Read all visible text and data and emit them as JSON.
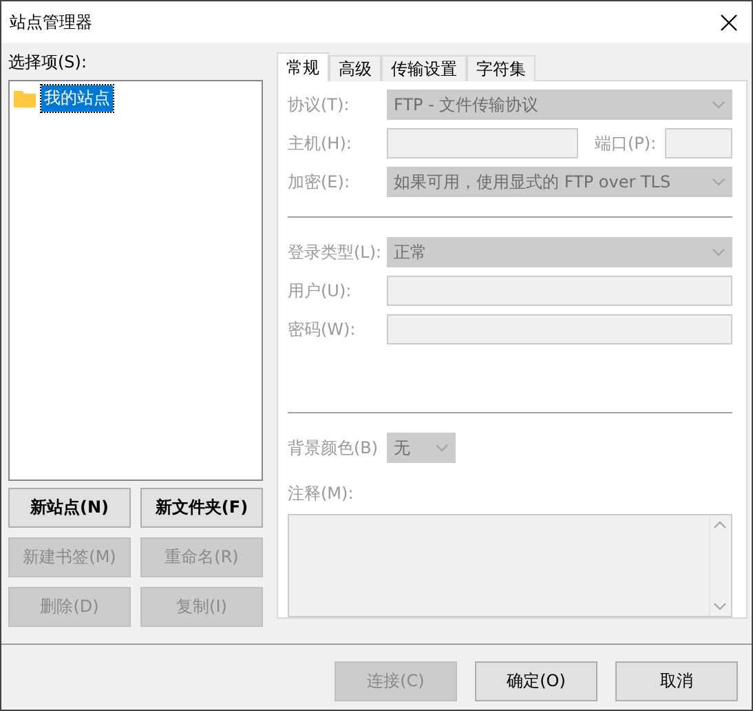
{
  "window": {
    "title": "站点管理器"
  },
  "tree": {
    "label": "选择项(S):",
    "items": [
      {
        "label": "我的站点",
        "selected": true
      }
    ]
  },
  "left_buttons": [
    {
      "label": "新站点(N)",
      "disabled": false
    },
    {
      "label": "新文件夹(F)",
      "disabled": false
    },
    {
      "label": "新建书签(M)",
      "disabled": true
    },
    {
      "label": "重命名(R)",
      "disabled": true
    },
    {
      "label": "删除(D)",
      "disabled": true
    },
    {
      "label": "复制(I)",
      "disabled": true
    }
  ],
  "tabs": [
    {
      "label": "常规",
      "selected": true
    },
    {
      "label": "高级",
      "selected": false
    },
    {
      "label": "传输设置",
      "selected": false
    },
    {
      "label": "字符集",
      "selected": false
    }
  ],
  "general": {
    "disabled": true,
    "connection_fields": [
      {
        "kind": "select",
        "label": "协议(T):",
        "value": "FTP - 文件传输协议"
      },
      {
        "kind": "host",
        "label": "主机(H):",
        "port_label": "端口(P):"
      },
      {
        "kind": "select",
        "label": "加密(E):",
        "value": "如果可用，使用显式的 FTP over TLS"
      }
    ],
    "login_fields": [
      {
        "kind": "select",
        "label": "登录类型(L):",
        "value": "正常"
      },
      {
        "kind": "input",
        "label": "用户(U):"
      },
      {
        "kind": "input",
        "label": "密码(W):"
      }
    ],
    "background_color": {
      "label": "背景颜色(B)",
      "value": "无"
    },
    "comments": {
      "label": "注释(M):"
    }
  },
  "footer_buttons": [
    {
      "label": "连接(C)",
      "disabled": true
    },
    {
      "label": "确定(O)",
      "disabled": false
    },
    {
      "label": "取消",
      "disabled": false
    }
  ]
}
